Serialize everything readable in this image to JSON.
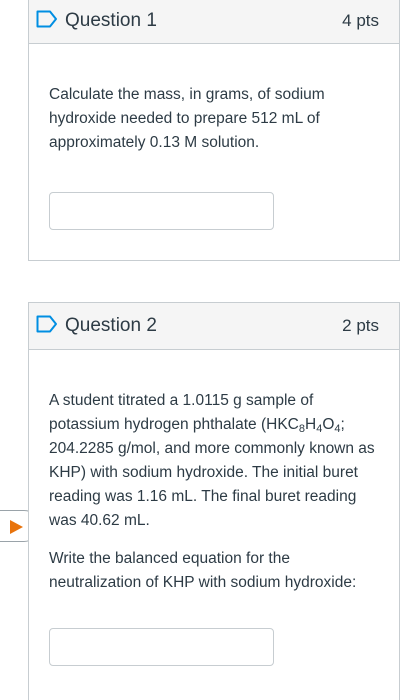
{
  "questions": [
    {
      "title": "Question 1",
      "points": "4 pts",
      "text": "Calculate the mass, in grams, of sodium hydroxide needed to prepare 512 mL of approximately 0.13 M solution.",
      "answer_value": ""
    },
    {
      "title": "Question 2",
      "points": "2 pts",
      "text_a": "A student titrated a 1.0115 g sample of potassium hydrogen phthalate (HKC",
      "formula": {
        "sub1": "8",
        "mid1": "H",
        "sub2": "4",
        "mid2": "O",
        "sub3": "4"
      },
      "text_b": "; 204.2285 g/mol, and more commonly known as KHP) with sodium hydroxide. The initial buret reading was 1.16 mL. The final buret reading was 40.62 mL.",
      "text2": "Write the balanced equation for the neutralization of KHP with sodium hydroxide:",
      "answer_value": ""
    }
  ],
  "colors": {
    "accent": "#008ee2",
    "flag": "#e8730c",
    "border": "#c7cdd1",
    "header_bg": "#f5f5f5",
    "text": "#2d3b45"
  },
  "icons": {
    "bookmark": "bookmark-outline-icon",
    "flag": "play-triangle-icon"
  }
}
